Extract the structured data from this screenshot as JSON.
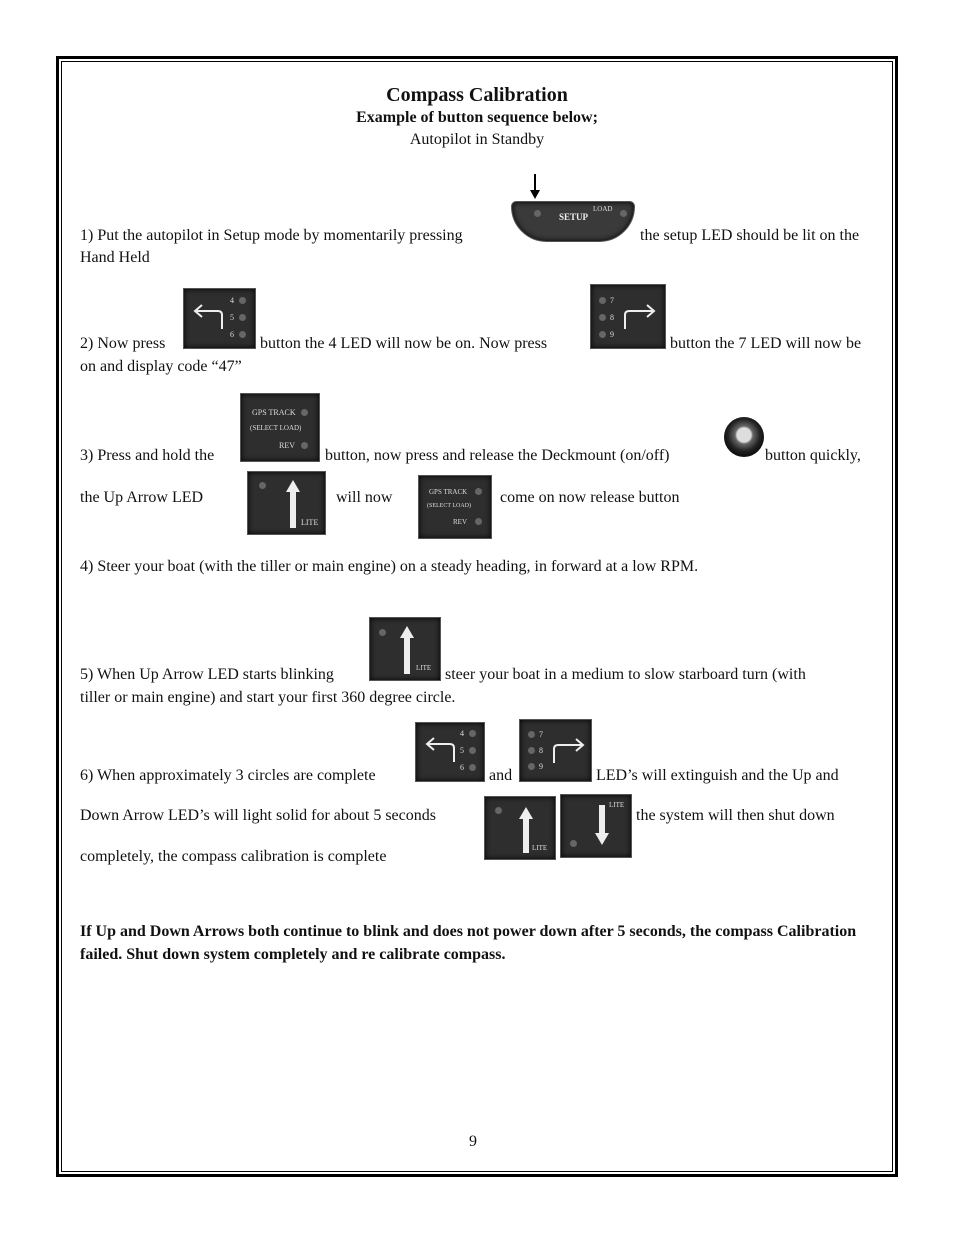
{
  "title": "Compass Calibration",
  "subtitle": "Example of button sequence below;",
  "state": "Autopilot in Standby",
  "steps": {
    "s1": {
      "a": "1) Put the autopilot in Setup mode by momentarily pressing",
      "b": "the setup LED should be lit on the",
      "c": "Hand Held"
    },
    "s2": {
      "a": "2)  Now press",
      "b": "button the 4 LED will now be on.  Now press",
      "c": "button the 7 LED will now be",
      "d": "on and display code “47”"
    },
    "s3": {
      "a": "3) Press and hold the",
      "b": "button, now press and release the Deckmount (on/off)",
      "c": "button quickly,",
      "d": "the  Up  Arrow  LED",
      "e": "will   now",
      "f": "come on now release button"
    },
    "s4": {
      "a": "4) Steer your boat (with the tiller or main engine) on a steady heading, in forward at a low RPM."
    },
    "s5": {
      "a": "5) When Up Arrow LED starts blinking",
      "b": "steer your boat in a medium to slow starboard turn (with",
      "c": "tiller or main engine) and start your first 360 degree circle."
    },
    "s6": {
      "a": "6) When approximately 3 circles are complete",
      "b": "and",
      "c": "LED’s will extinguish and the Up and",
      "d": "Down Arrow LED’s will light solid for about 5 seconds",
      "e": "the system will then shut down",
      "f": "completely, the compass calibration is complete"
    }
  },
  "warning": "If Up and Down Arrows both continue to blink and does not power down after 5 seconds, the compass Calibration failed.  Shut down system completely and re calibrate compass.",
  "page_number": "9",
  "buttons": {
    "setup": {
      "main": "SETUP",
      "corner": "LOAD"
    },
    "left": {
      "leds": [
        "4",
        "5",
        "6"
      ]
    },
    "right": {
      "leds": [
        "7",
        "8",
        "9"
      ]
    },
    "gps": {
      "line1": "GPS TRACK",
      "line2": "(SELECT LOAD)",
      "line3": "REV"
    },
    "lite": "LITE"
  }
}
